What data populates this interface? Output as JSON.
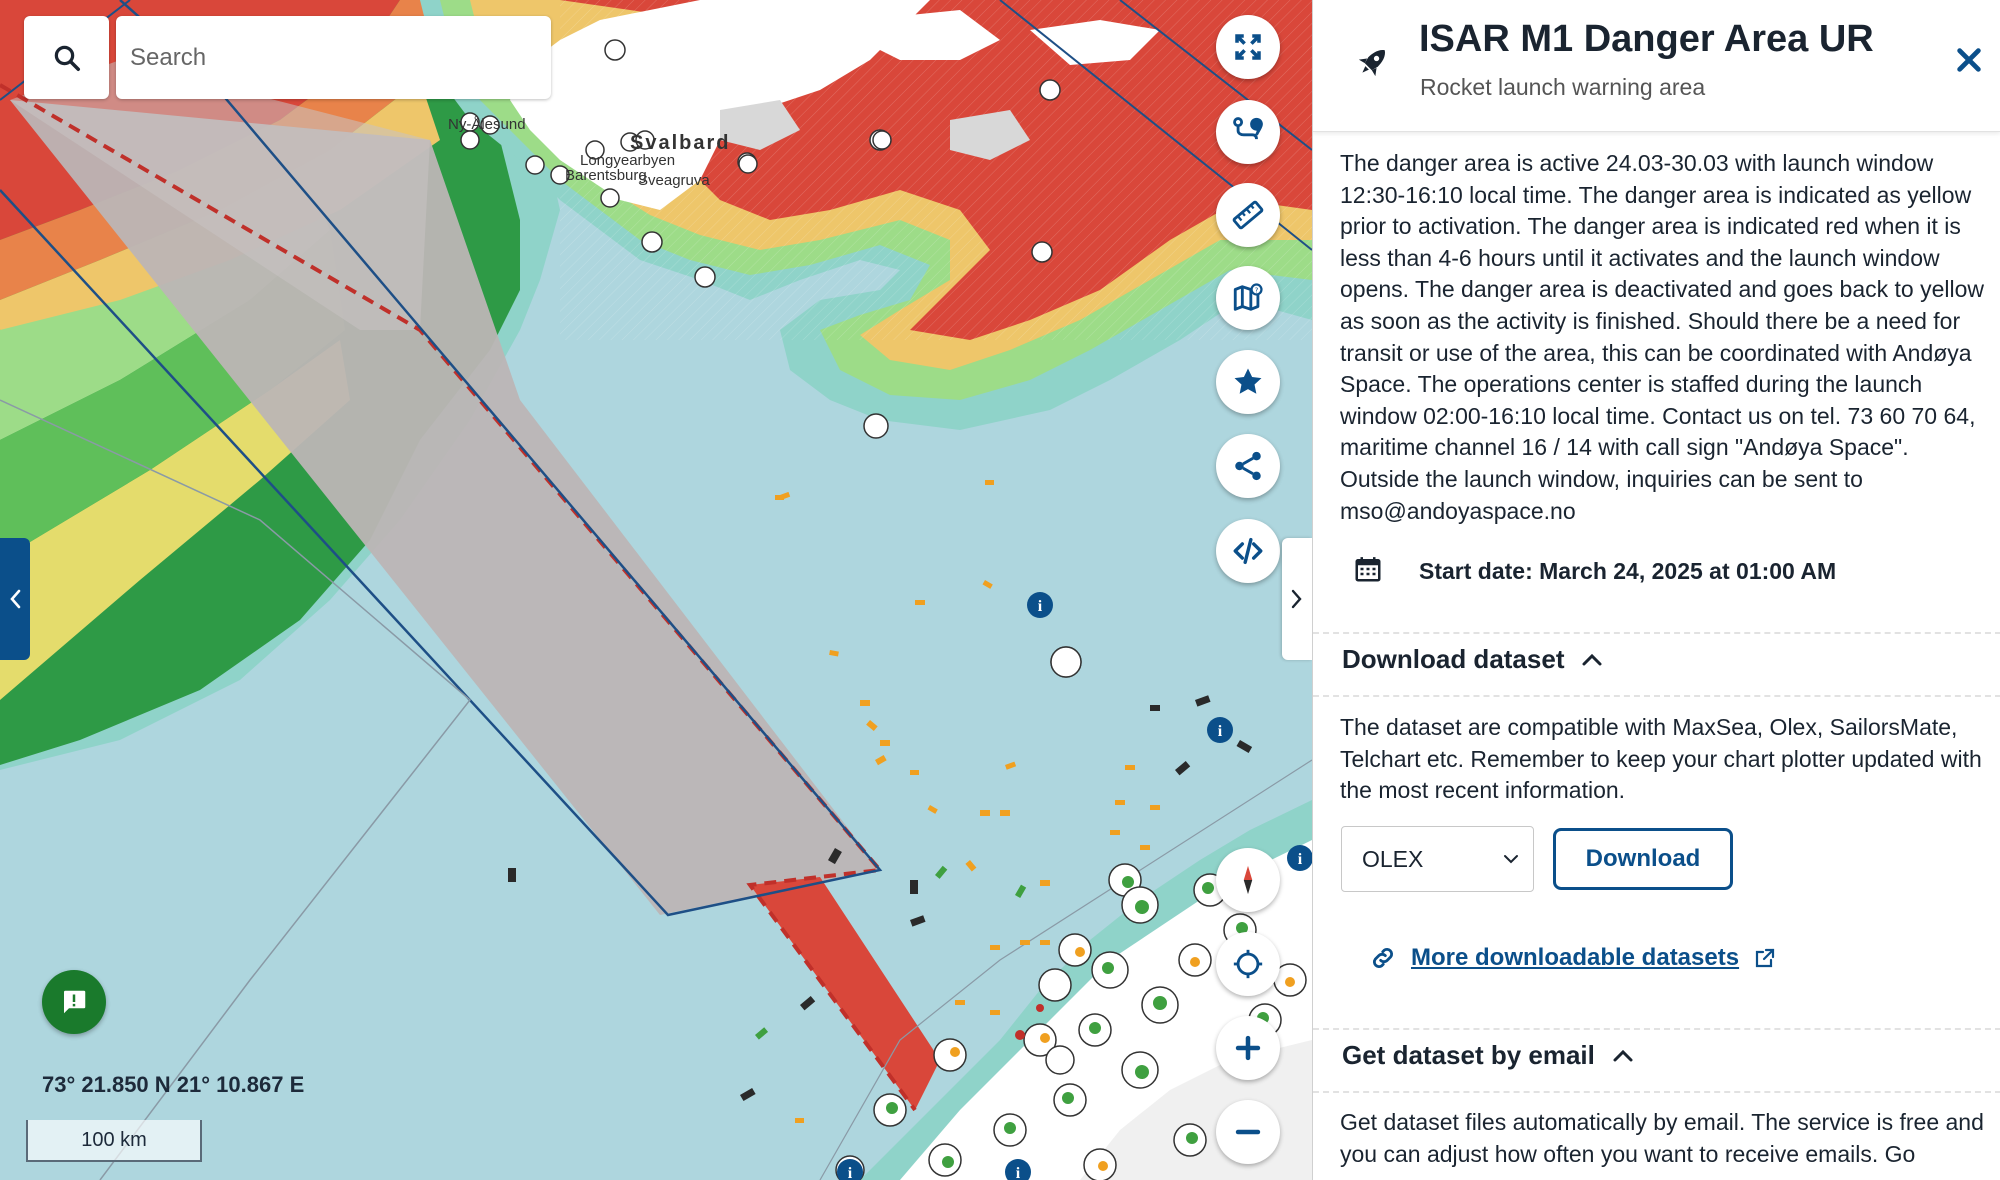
{
  "search": {
    "placeholder": "Search"
  },
  "map": {
    "places": [
      "Ny-Ålesund",
      "Svalbard",
      "Longyearbyen",
      "Barentsburg",
      "Sveagruva"
    ],
    "coordinates": "73° 21.850 N 21° 10.867 E",
    "scale_label": "100 km"
  },
  "icons": {
    "search": "search-icon",
    "fullscreen": "fullscreen-icon",
    "route": "route-icon",
    "ruler": "ruler-icon",
    "map_layers": "map-layers-icon",
    "favorite": "star-icon",
    "share": "share-icon",
    "embed": "code-icon",
    "compass": "compass-icon",
    "locate": "locate-icon",
    "zoom_in": "plus-icon",
    "zoom_out": "minus-icon",
    "feedback": "feedback-icon",
    "rocket": "rocket-icon",
    "close": "close-icon",
    "calendar": "calendar-icon",
    "link": "link-icon",
    "external": "external-link-icon"
  },
  "colors": {
    "brand_blue": "#0b4f8a",
    "danger_red": "#d9473a",
    "feedback_green": "#1a7a2c",
    "sea": "#aed6de",
    "danger_area_fill": "#b9b3b3"
  },
  "panel": {
    "title": "ISAR M1 Danger Area UR",
    "subtitle": "Rocket launch warning area",
    "description": "The danger area is active 24.03-30.03 with launch window 12:30-16:10 local time. The danger area is indicated as yellow prior to activation. The danger area is indicated red when it is less than 4-6 hours until it activates and the launch window opens. The danger area is deactivated and goes back to yellow as soon as the activity is finished. Should there be a need for transit or use of the area, this can be coordinated with Andøya Space. The operations center is staffed during the launch window 02:00-16:10 local time. Contact us on tel. 73 60 70 64, maritime channel 16 / 14 with call sign \"Andøya Space\". Outside the launch window, inquiries can be sent to mso@andoyaspace.no",
    "start_date": "Start date: March 24, 2025 at 01:00 AM",
    "download": {
      "heading": "Download dataset",
      "text": "The dataset are compatible with MaxSea, Olex, SailorsMate, Telchart etc. Remember to keep your chart plotter updated with the most recent information.",
      "format_selected": "OLEX",
      "button": "Download",
      "more_link": "More downloadable datasets"
    },
    "email": {
      "heading": "Get dataset by email",
      "text": "Get dataset files automatically by email. The service is free and you can adjust how often you want to receive emails. Go"
    }
  }
}
